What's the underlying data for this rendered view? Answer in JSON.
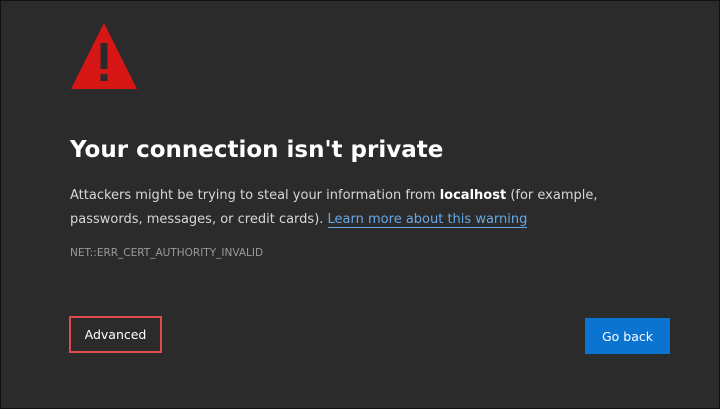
{
  "page": {
    "title": "Your connection isn't private",
    "description_prefix": "Attackers might be trying to steal your information from ",
    "host": "localhost",
    "description_suffix": " (for example, passwords, messages, or credit cards). ",
    "learn_more_link": "Learn more about this warning",
    "error_code": "NET::ERR_CERT_AUTHORITY_INVALID"
  },
  "buttons": {
    "advanced_label": "Advanced",
    "go_back_label": "Go back"
  },
  "icons": {
    "warning": "warning-triangle-icon"
  },
  "colors": {
    "background": "#2b2b2b",
    "warning_red": "#d61515",
    "link": "#66a9e6",
    "primary_button": "#0b74d0",
    "highlight_border": "#e04a4a"
  }
}
